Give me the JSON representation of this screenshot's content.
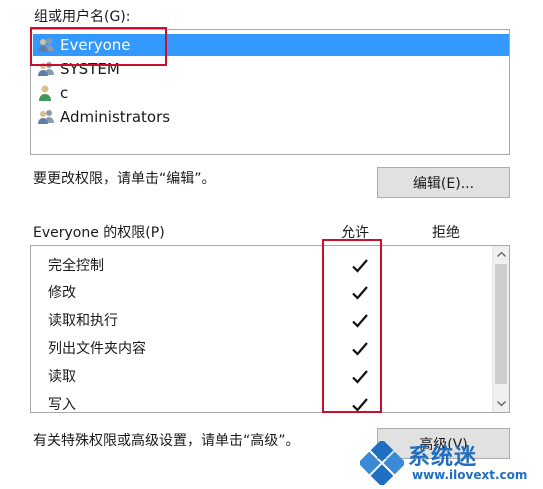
{
  "groups": {
    "label": "组或用户名(G):",
    "items": [
      {
        "name": "Everyone",
        "selected": true,
        "icon": "users-icon"
      },
      {
        "name": "SYSTEM",
        "selected": false,
        "icon": "users-icon"
      },
      {
        "name": "c",
        "selected": false,
        "icon": "user-icon"
      },
      {
        "name": "Administrators",
        "selected": false,
        "icon": "users-icon"
      }
    ]
  },
  "edit_hint": "要更改权限，请单击“编辑”。",
  "edit_button": "编辑(E)...",
  "permissions": {
    "title": "Everyone 的权限(P)",
    "allow_header": "允许",
    "deny_header": "拒绝",
    "rows": [
      {
        "name": "完全控制",
        "allow": true,
        "deny": false
      },
      {
        "name": "修改",
        "allow": true,
        "deny": false
      },
      {
        "name": "读取和执行",
        "allow": true,
        "deny": false
      },
      {
        "name": "列出文件夹内容",
        "allow": true,
        "deny": false
      },
      {
        "name": "读取",
        "allow": true,
        "deny": false
      },
      {
        "name": "写入",
        "allow": true,
        "deny": false
      }
    ]
  },
  "advanced_hint": "有关特殊权限或高级设置，请单击“高级”。",
  "advanced_button": "高级(V)",
  "watermark": {
    "text": "系统迷",
    "url": "www.ilovext.com"
  },
  "colors": {
    "selection": "#3399ff",
    "highlight": "#c8102e",
    "watermark": "#1e6fc1"
  }
}
